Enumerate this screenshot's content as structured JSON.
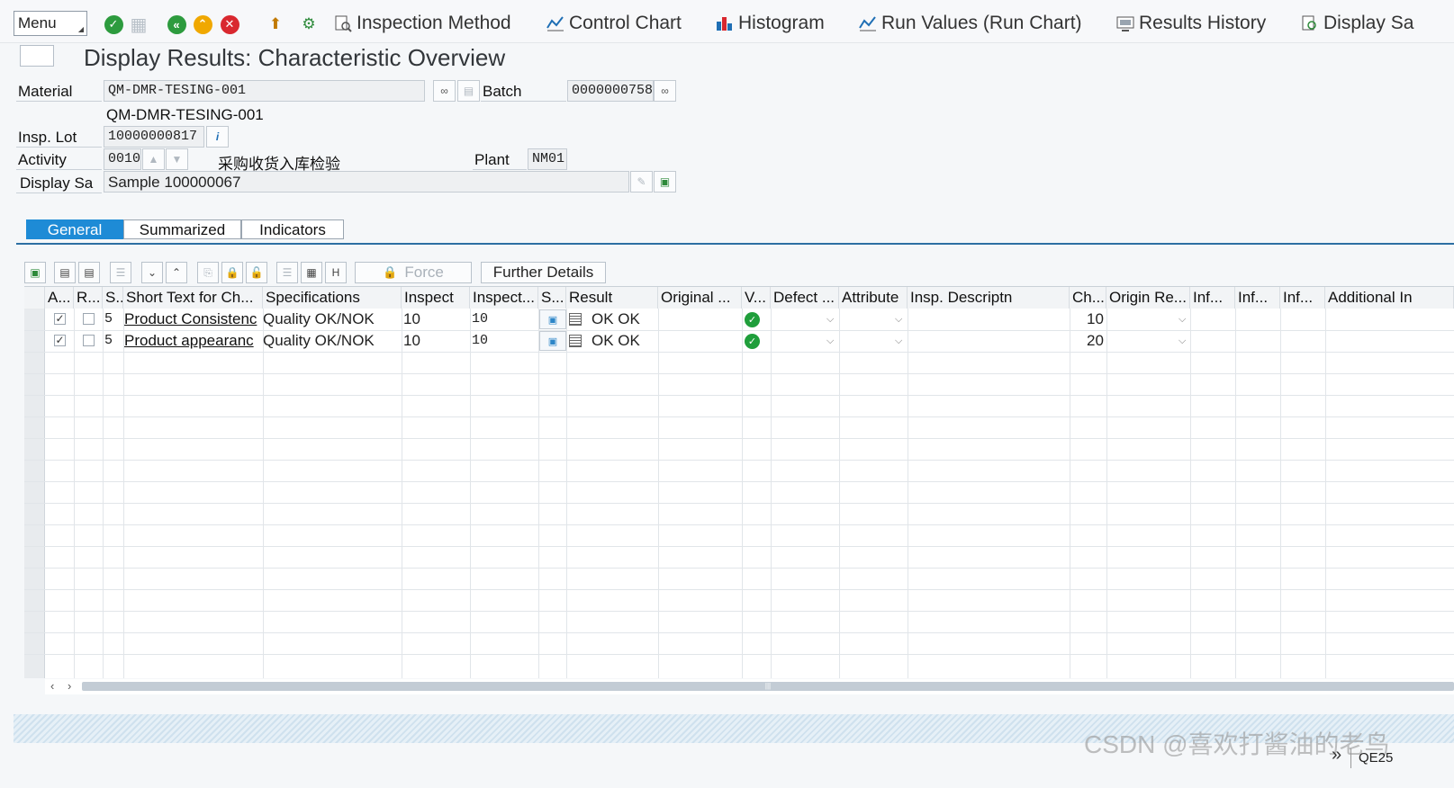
{
  "toolbar": {
    "menu_label": "Menu",
    "buttons": {
      "inspection_method": "Inspection Method",
      "control_chart": "Control Chart",
      "histogram": "Histogram",
      "run_values": "Run Values (Run Chart)",
      "results_history": "Results History",
      "display_sa": "Display Sa"
    }
  },
  "page": {
    "title": "Display Results: Characteristic Overview"
  },
  "header": {
    "material_label": "Material",
    "material_value": "QM-DMR-TESING-001",
    "material_desc": "QM-DMR-TESING-001",
    "batch_label": "Batch",
    "batch_value": "0000000758",
    "insp_lot_label": "Insp. Lot",
    "insp_lot_value": "10000000817",
    "activity_label": "Activity",
    "activity_value": "0010",
    "activity_desc": "采购收货入库检验",
    "plant_label": "Plant",
    "plant_value": "NM01",
    "display_sa_label": "Display Sa",
    "display_sa_value": "Sample 100000067"
  },
  "tabs": {
    "general": "General",
    "summarized": "Summarized",
    "indicators": "Indicators"
  },
  "grid_toolbar": {
    "force": "Force",
    "further_details": "Further Details"
  },
  "grid": {
    "columns": {
      "a": "A...",
      "r": "R...",
      "s": "S..",
      "short_text": "Short Text for Ch...",
      "specifications": "Specifications",
      "inspect": "Inspect",
      "inspect2": "Inspect...",
      "s2": "S...",
      "result": "Result",
      "original": "Original ...",
      "v": "V...",
      "defect": "Defect ...",
      "attribute": "Attribute",
      "insp_descr": "Insp. Descriptn",
      "ch": "Ch...",
      "origin_re": "Origin Re...",
      "inf1": "Inf...",
      "inf2": "Inf...",
      "inf3": "Inf...",
      "additional": "Additional In"
    },
    "rows": [
      {
        "a_checked": true,
        "r_checked": false,
        "s": "5",
        "short_text": "Product Consistenc",
        "specifications": "Quality OK/NOK",
        "inspect": "10",
        "inspect2": "10",
        "result": "OK OK",
        "ch": "10"
      },
      {
        "a_checked": true,
        "r_checked": false,
        "s": "5",
        "short_text": "Product appearanc",
        "specifications": "Quality OK/NOK",
        "inspect": "10",
        "inspect2": "10",
        "result": "OK OK",
        "ch": "20"
      }
    ]
  },
  "status": {
    "watermark": "CSDN @喜欢打酱油的老鸟",
    "tcode": "QE25"
  },
  "colors": {
    "active_tab": "#1e8bd6",
    "ok_green": "#1f9e3b",
    "cancel_red": "#d9282f"
  }
}
